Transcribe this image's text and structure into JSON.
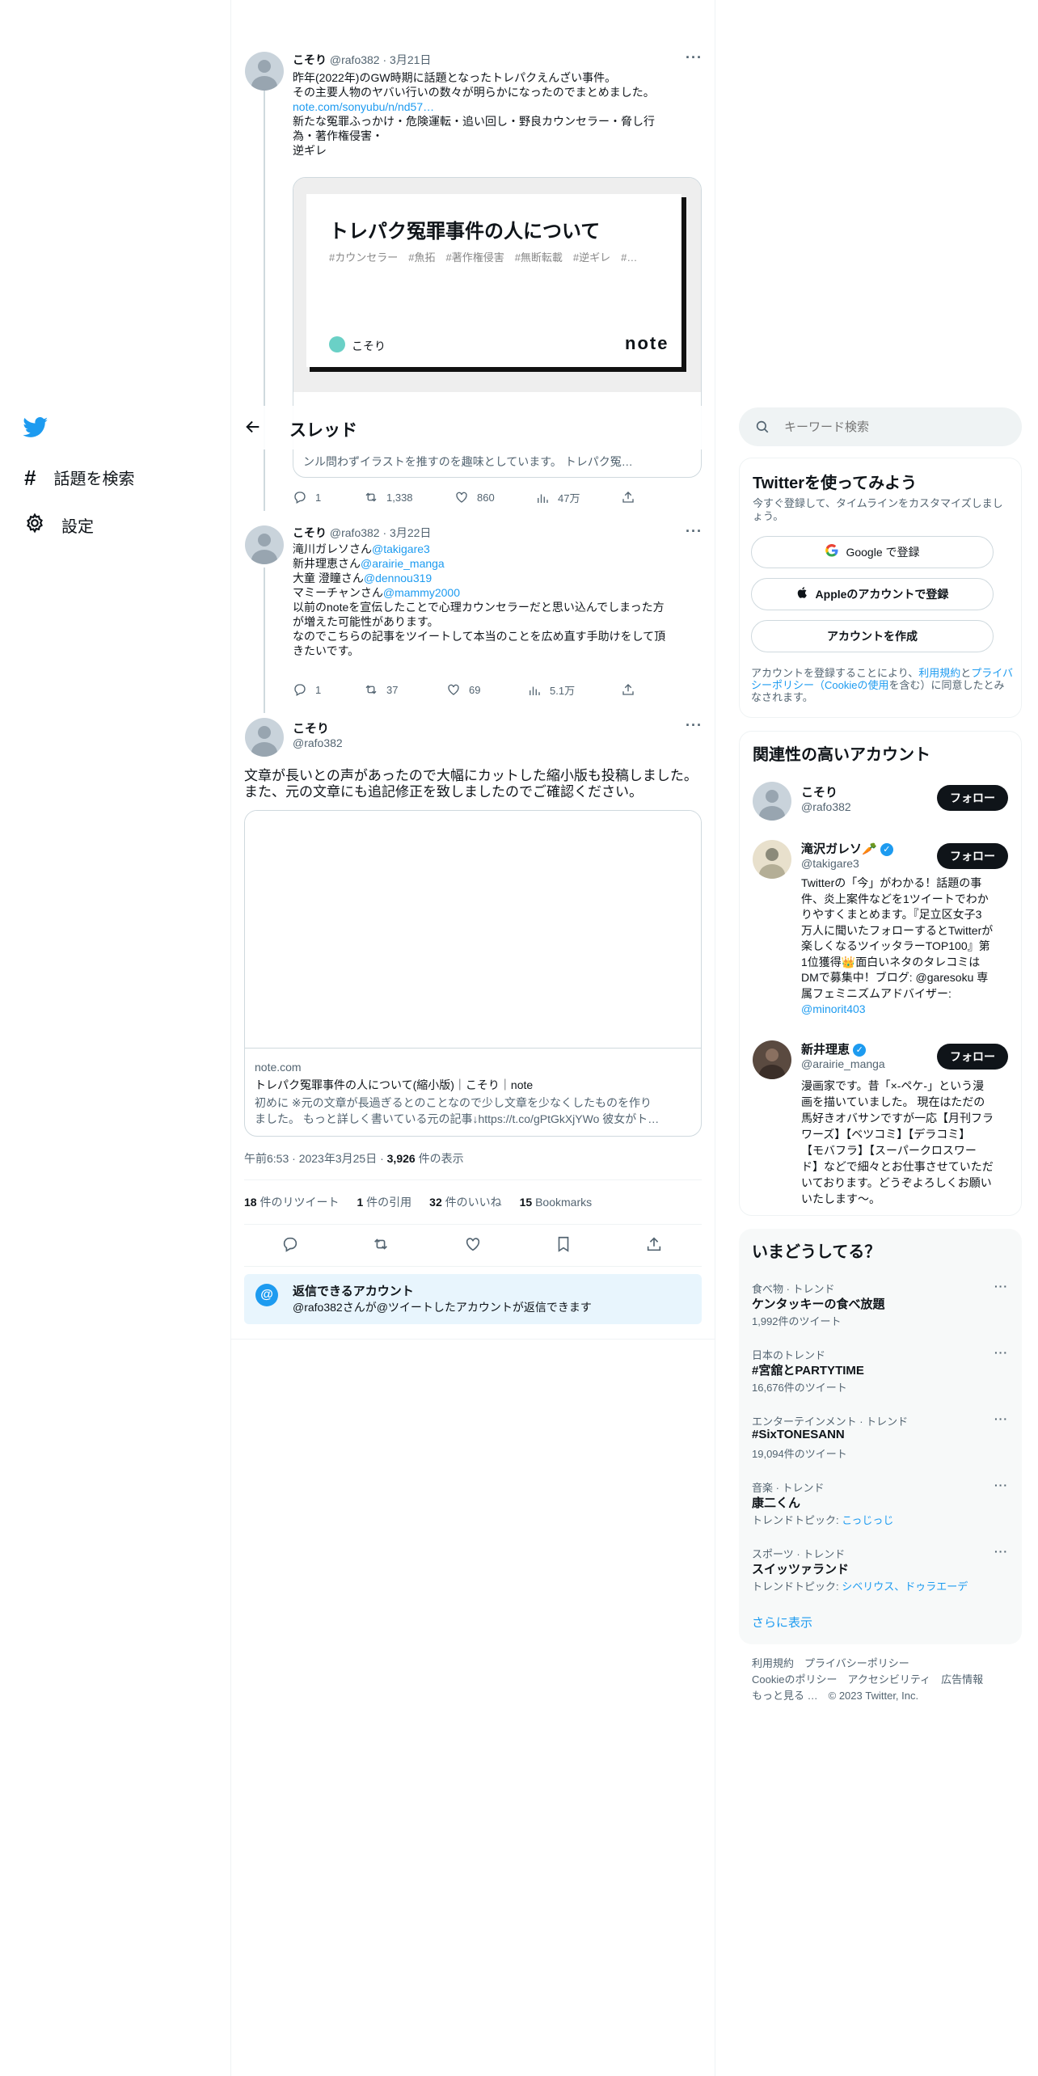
{
  "nav": {
    "explore_label": "話題を検索",
    "settings_label": "設定"
  },
  "header": {
    "title": "スレッド"
  },
  "tweets": [
    {
      "author_name": "こそり",
      "author_handle": "@rafo382",
      "date": "· 3月21日",
      "lines": [
        "昨年(2022年)のGW時期に話題となったトレパクえんざい事件。",
        "その主要人物のヤバい行いの数々が明らかになったのでまとめました。"
      ],
      "link": "note.com/sonyubu/n/nd57…",
      "lines2": [
        "新たな冤罪ふっかけ・危険運転・追い回し・野良カウンセラー・脅し行",
        "為・著作権侵害・",
        "逆ギレ"
      ],
      "card": {
        "title": "トレパク冤罪事件の人について",
        "tags": "#カウンセラー　#魚拓　#著作権侵害　#無断転載　#逆ギレ　#…",
        "author": "こそり",
        "brand": "note",
        "desc": "ンル問わずイラストを推すのを趣味としています。 トレパク冤…"
      },
      "stats": {
        "replies": "1",
        "retweets": "1,338",
        "likes": "860",
        "views": "47万"
      }
    },
    {
      "author_name": "こそり",
      "author_handle": "@rafo382",
      "date": "· 3月22日",
      "lines": [
        [
          "滝川ガレソさん",
          "@takigare3"
        ],
        [
          "新井理恵さん",
          "@arairie_manga"
        ],
        [
          "大童 澄瞳さん",
          "@dennou319"
        ],
        [
          "マミーチャンさん",
          "@mammy2000"
        ]
      ],
      "tail": [
        "以前のnoteを宣伝したことで心理カウンセラーだと思い込んでしまった方",
        "が増えた可能性があります。",
        "なのでこちらの記事をツイートして本当のことを広め直す手助けをして頂",
        "きたいです。"
      ],
      "stats": {
        "replies": "1",
        "retweets": "37",
        "likes": "69",
        "views": "5.1万"
      }
    }
  ],
  "main_tweet": {
    "author_name": "こそり",
    "author_handle": "@rafo382",
    "text_line1": "文章が長いとの声があったので大幅にカットした縮小版も投稿しました。",
    "text_line2": "また、元の文章にも追記修正を致しましたのでご確認ください。",
    "card": {
      "domain": "note.com",
      "title": "トレパク冤罪事件の人について(縮小版)｜こそり｜note",
      "desc1": "初めに ※元の文章が長過ぎるとのことなので少し文章を少なくしたものを作り",
      "desc2": "ました。 もっと詳しく書いている元の記事↓https://t.co/gPtGkXjYWo 彼女がト…"
    },
    "timestamp": "午前6:53 · 2023年3月25日 · ",
    "views_count": "3,926",
    "views_label": " 件の表示",
    "engagement": {
      "retweets": "18",
      "retweets_label": " 件のリツイート",
      "quotes": "1",
      "quotes_label": " 件の引用",
      "likes": "32",
      "likes_label": " 件のいいね",
      "bookmarks": "15",
      "bookmarks_label": " Bookmarks"
    },
    "reply_notice": {
      "title": "返信できるアカウント",
      "body": "@rafo382さんが@ツイートしたアカウントが返信できます"
    }
  },
  "search": {
    "placeholder": "キーワード検索"
  },
  "signup": {
    "title": "Twitterを使ってみよう",
    "subtitle": "今すぐ登録して、タイムラインをカスタマイズしましょう。",
    "google": "Google で登録",
    "apple": "Appleのアカウントで登録",
    "create": "アカウントを作成",
    "terms_a": "アカウントを登録することにより、",
    "terms_link1": "利用規約",
    "terms_b": "と",
    "terms_link2": "プライバシーポリシー（Cookieの使用",
    "terms_c": "を含む）に同意したとみなされます。"
  },
  "related": {
    "title": "関連性の高いアカウント",
    "follow_label": "フォロー",
    "accounts": [
      {
        "name": "こそり",
        "handle": "@rafo382",
        "bio": []
      },
      {
        "name": "滝沢ガレソ🥕",
        "handle": "@takigare3",
        "bio": [
          "Twitterの「今」がわかる！話題の事",
          "件、炎上案件などを1ツイートでわか",
          "りやすくまとめます。『足立区女子3",
          "万人に聞いたフォローするとTwitterが",
          "楽しくなるツイッタラーTOP100』第",
          "1位獲得👑面白いネタのタレコミは",
          "DMで募集中！ブログ: @garesoku 専",
          "属フェミニズムアドバイザー:",
          "@minorit403"
        ]
      },
      {
        "name": "新井理恵",
        "handle": "@arairie_manga",
        "bio": [
          "漫画家です。昔「×-ペケ-」という漫",
          "画を描いていました。 現在はただの",
          "馬好きオバサンですが一応【月刊フラ",
          "ワーズ】【ベツコミ】【デラコミ】",
          "【モバフラ】【スーパークロスワー",
          "ド】などで細々とお仕事させていただ",
          "いております。どうぞよろしくお願い",
          "いたします〜。"
        ]
      }
    ]
  },
  "trends": {
    "title": "いまどうしてる？",
    "items": [
      {
        "meta": "食べ物 · トレンド",
        "name": "ケンタッキーの食べ放題",
        "sub": "1,992件のツイート"
      },
      {
        "meta": "日本のトレンド",
        "name": "#宮舘とPARTYTIME",
        "sub": "16,676件のツイート"
      },
      {
        "meta": "エンターテインメント · トレンド",
        "name": "#SixTONESANN",
        "sub": "19,094件のツイート"
      },
      {
        "meta": "音楽 · トレンド",
        "name": "康二くん",
        "sub_label": "トレンドトピック: ",
        "sub_link": "こっじっじ"
      },
      {
        "meta": "スポーツ · トレンド",
        "name": "スイッツァランド",
        "sub_label": "トレンドトピック: ",
        "sub_link": "シベリウス、ドゥラエーデ"
      }
    ],
    "show_more": "さらに表示"
  },
  "footer": {
    "row1": [
      "利用規約",
      "プライバシーポリシー"
    ],
    "row2": [
      "Cookieのポリシー",
      "アクセシビリティ",
      "広告情報"
    ],
    "more": "もっと見る …",
    "copyright": "© 2023 Twitter, Inc."
  },
  "colors": {
    "accent": "#1d9bf0",
    "text": "#0f1419",
    "muted": "#536471"
  }
}
